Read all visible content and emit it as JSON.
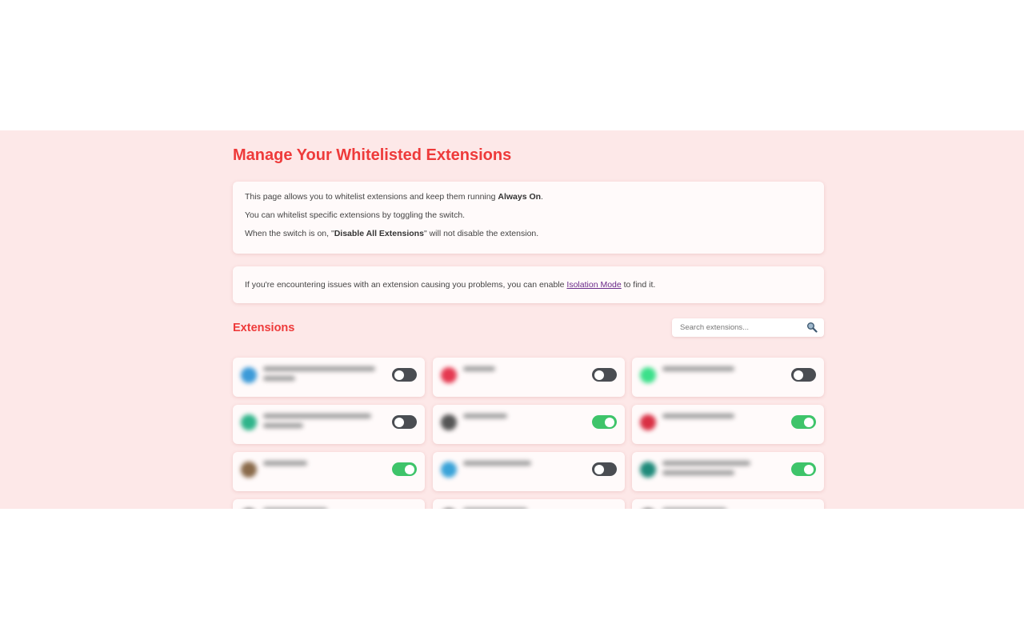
{
  "header": {
    "title": "Manage Your Whitelisted Extensions"
  },
  "info": {
    "line1_prefix": "This page allows you to whitelist extensions and keep them running ",
    "line1_bold": "Always On",
    "line1_suffix": ".",
    "line2": "You can whitelist specific extensions by toggling the switch.",
    "line3_prefix": "When the switch is on, \"",
    "line3_bold": "Disable All Extensions",
    "line3_suffix": "\" will not disable the extension."
  },
  "isolation": {
    "prefix": "If you're encountering issues with an extension causing you problems, you can enable ",
    "link": "Isolation Mode",
    "suffix": " to find it."
  },
  "extensions_section": {
    "title": "Extensions",
    "search_placeholder": "Search extensions..."
  },
  "extensions": [
    {
      "enabled": false,
      "icon_color": "#3b9ad8"
    },
    {
      "enabled": false,
      "icon_color": "#e53950"
    },
    {
      "enabled": false,
      "icon_color": "#3ce08a"
    },
    {
      "enabled": false,
      "icon_color": "#2fb48a"
    },
    {
      "enabled": true,
      "icon_color": "#555555"
    },
    {
      "enabled": true,
      "icon_color": "#d93044"
    },
    {
      "enabled": true,
      "icon_color": "#8a6a4a"
    },
    {
      "enabled": false,
      "icon_color": "#3aa3d8"
    },
    {
      "enabled": true,
      "icon_color": "#1f8a7a"
    }
  ],
  "colors": {
    "accent": "#ee3a3a",
    "background": "#fde8e8",
    "toggle_on": "#3ec46a",
    "toggle_off": "#4a4d52"
  }
}
